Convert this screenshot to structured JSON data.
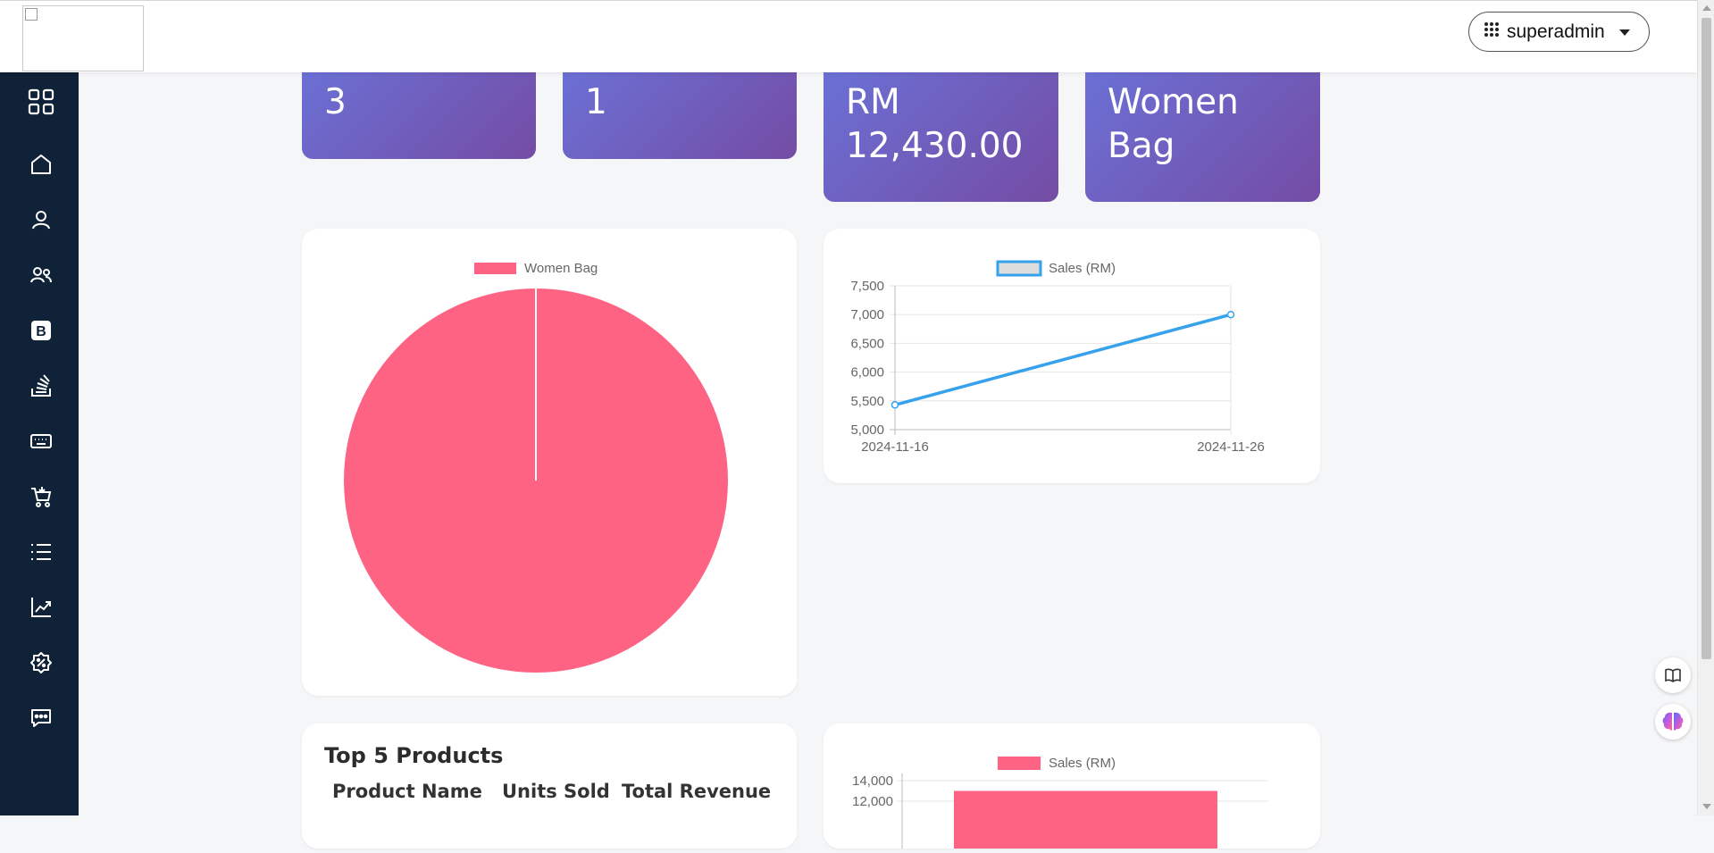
{
  "header": {
    "user_label": "superadmin",
    "user_icon": "grid-dots-icon",
    "dropdown_icon": "caret-down-icon"
  },
  "sidebar": {
    "items": [
      {
        "icon": "dashboard-grid-icon"
      },
      {
        "icon": "home-icon"
      },
      {
        "icon": "user-icon"
      },
      {
        "icon": "users-icon"
      },
      {
        "icon": "brand-b-icon"
      },
      {
        "icon": "stack-icon"
      },
      {
        "icon": "keyboard-icon"
      },
      {
        "icon": "cart-icon"
      },
      {
        "icon": "list-icon"
      },
      {
        "icon": "chart-line-icon"
      },
      {
        "icon": "discount-badge-icon"
      },
      {
        "icon": "chat-dots-icon"
      }
    ]
  },
  "stats": [
    {
      "value": "3"
    },
    {
      "value": "1"
    },
    {
      "value_line1": "RM",
      "value_line2": "12,430.00"
    },
    {
      "value_line1": "Women",
      "value_line2": "Bag"
    }
  ],
  "pie_chart": {
    "legend": "Women Bag"
  },
  "line_chart": {
    "legend": "Sales (RM)"
  },
  "top_products": {
    "title": "Top 5 Products",
    "columns": [
      "Product Name",
      "Units Sold",
      "Total Revenue"
    ]
  },
  "bar_chart": {
    "legend": "Sales (RM)"
  },
  "colors": {
    "sidebar": "#0f2238",
    "pie": "#ff6384",
    "line": "#36a2eb",
    "bar": "#ff6384",
    "card_gradient_start": "#6a74da",
    "card_gradient_end": "#744ca4"
  },
  "chart_data": [
    {
      "type": "pie",
      "categories": [
        "Women Bag"
      ],
      "values": [
        100
      ],
      "legend": "top"
    },
    {
      "type": "line",
      "x": [
        "2024-11-16",
        "2024-11-26"
      ],
      "series": [
        {
          "name": "Sales (RM)",
          "values": [
            5430,
            7000
          ]
        }
      ],
      "ylim": [
        5000,
        7500
      ],
      "yticks": [
        "5,000",
        "5,500",
        "6,000",
        "6,500",
        "7,000",
        "7,500"
      ],
      "grid": true,
      "legend": "top"
    },
    {
      "type": "bar",
      "series": [
        {
          "name": "Sales (RM)",
          "values": [
            13000
          ]
        }
      ],
      "yticks_visible": [
        "12,000",
        "14,000"
      ],
      "grid": true,
      "legend": "top"
    }
  ]
}
